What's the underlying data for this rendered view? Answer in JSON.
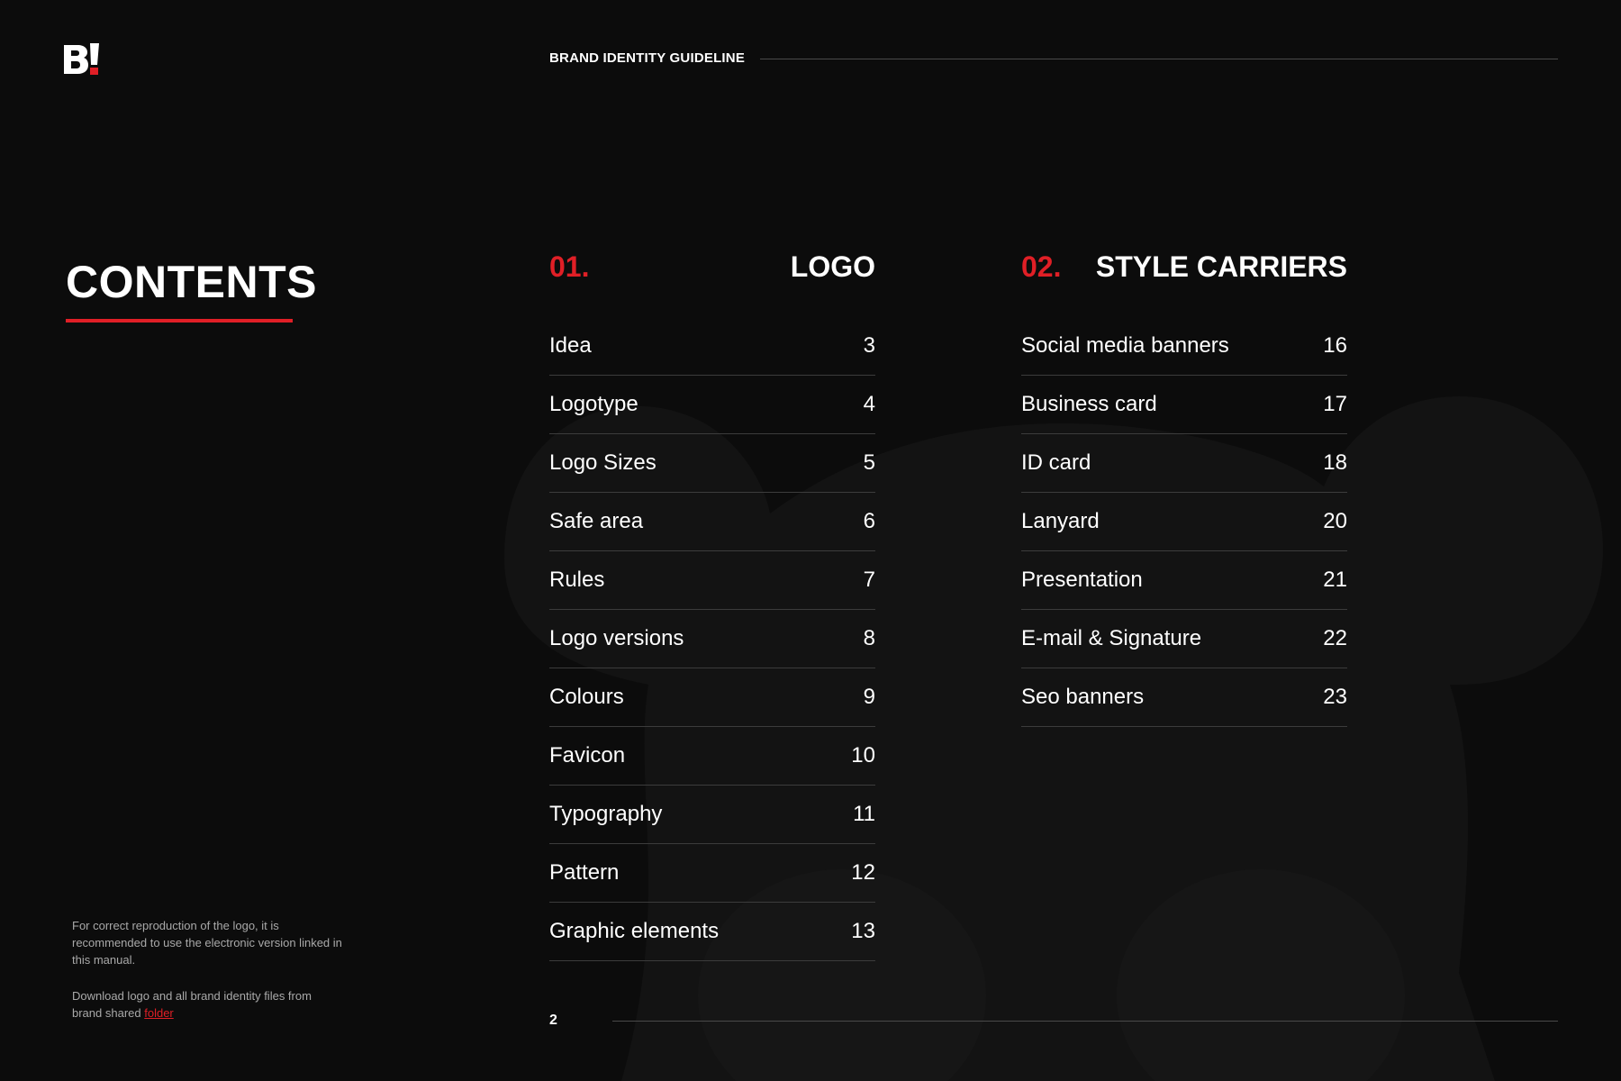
{
  "header": {
    "brand_mark": "B!",
    "title": "BRAND IDENTITY GUIDELINE"
  },
  "contents": {
    "heading": "CONTENTS",
    "accent_color": "#e01f26"
  },
  "sections": [
    {
      "number": "01.",
      "title": "LOGO",
      "items": [
        {
          "label": "Idea",
          "page": "3"
        },
        {
          "label": "Logotype",
          "page": "4"
        },
        {
          "label": "Logo Sizes",
          "page": "5"
        },
        {
          "label": "Safe area",
          "page": "6"
        },
        {
          "label": "Rules",
          "page": "7"
        },
        {
          "label": "Logo versions",
          "page": "8"
        },
        {
          "label": "Colours",
          "page": "9"
        },
        {
          "label": "Favicon",
          "page": "10"
        },
        {
          "label": "Typography",
          "page": "11"
        },
        {
          "label": "Pattern",
          "page": "12"
        },
        {
          "label": "Graphic elements",
          "page": "13"
        }
      ]
    },
    {
      "number": "02.",
      "title": "STYLE CARRIERS",
      "items": [
        {
          "label": "Social media banners",
          "page": "16"
        },
        {
          "label": "Business card",
          "page": "17"
        },
        {
          "label": "ID card",
          "page": "18"
        },
        {
          "label": "Lanyard",
          "page": "20"
        },
        {
          "label": "Presentation",
          "page": "21"
        },
        {
          "label": "E-mail & Signature",
          "page": "22"
        },
        {
          "label": "Seo banners",
          "page": "23"
        }
      ]
    }
  ],
  "notes": {
    "reproduction": "For correct reproduction of the logo, it is recommended to use the electronic version linked in this manual.",
    "download_text": "Download logo and all brand identity files from brand shared ",
    "download_link": "folder"
  },
  "footer": {
    "page_number": "2"
  }
}
